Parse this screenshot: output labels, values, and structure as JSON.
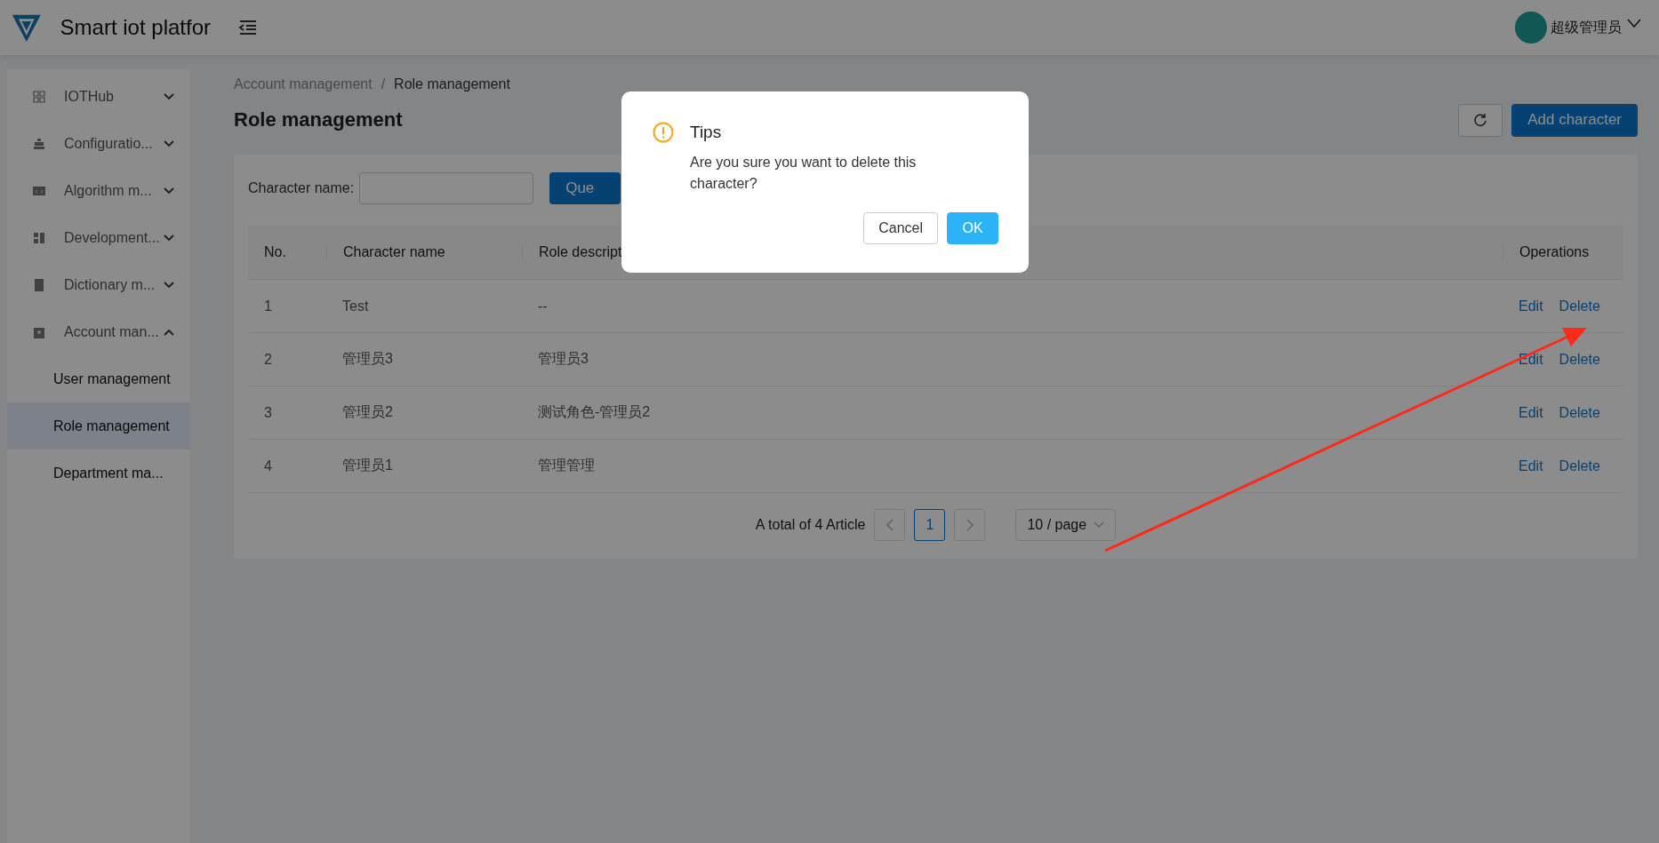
{
  "header": {
    "title": "Smart iot platfor",
    "user": "超级管理员"
  },
  "sidebar": {
    "items": [
      {
        "label": "IOTHub",
        "expanded": false
      },
      {
        "label": "Configuratio...",
        "expanded": false
      },
      {
        "label": "Algorithm m...",
        "expanded": false
      },
      {
        "label": "Development...",
        "expanded": false
      },
      {
        "label": "Dictionary m...",
        "expanded": false
      },
      {
        "label": "Account man...",
        "expanded": true,
        "children": [
          {
            "label": "User management",
            "selected": false
          },
          {
            "label": "Role management",
            "selected": true
          },
          {
            "label": "Department ma...",
            "selected": false
          }
        ]
      }
    ]
  },
  "breadcrumb": {
    "separator": "/",
    "items": [
      "Account management",
      "Role management"
    ]
  },
  "page_title": "Role management",
  "actions": {
    "add_button": "Add character"
  },
  "filter": {
    "label": "Character name:",
    "query_button": "Que"
  },
  "table": {
    "columns": [
      "No.",
      "Character name",
      "Role descript",
      "Operations"
    ],
    "rows": [
      {
        "no": "1",
        "name": "Test",
        "description": "--",
        "actions": [
          "Edit",
          "Delete"
        ]
      },
      {
        "no": "2",
        "name": "管理员3",
        "description": "管理员3",
        "actions": [
          "Edit",
          "Delete"
        ]
      },
      {
        "no": "3",
        "name": "管理员2",
        "description": "测试角色-管理员2",
        "actions": [
          "Edit",
          "Delete"
        ]
      },
      {
        "no": "4",
        "name": "管理员1",
        "description": "管理管理",
        "actions": [
          "Edit",
          "Delete"
        ]
      }
    ]
  },
  "pagination": {
    "total": "A total of 4 Article",
    "pages": [
      {
        "label": "1",
        "selected": true
      }
    ],
    "page_size": "10 / page"
  },
  "dialog": {
    "title": "Tips",
    "message": "Are you sure you want to delete this character?",
    "buttons": [
      {
        "label": "Cancel",
        "kind": "secondary"
      },
      {
        "label": "OK",
        "kind": "primary"
      }
    ]
  }
}
